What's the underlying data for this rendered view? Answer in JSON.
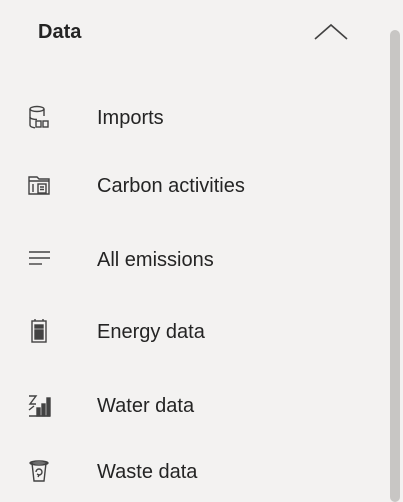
{
  "group": {
    "title": "Data",
    "expanded": true,
    "chevron_icon": "chevron-up-icon"
  },
  "items": [
    {
      "label": "Imports",
      "icon": "database-import-icon"
    },
    {
      "label": "Carbon activities",
      "icon": "activities-document-icon"
    },
    {
      "label": "All emissions",
      "icon": "list-lines-icon"
    },
    {
      "label": "Energy data",
      "icon": "energy-meter-icon"
    },
    {
      "label": "Water data",
      "icon": "water-chart-icon"
    },
    {
      "label": "Waste data",
      "icon": "waste-bin-icon"
    }
  ],
  "colors": {
    "background": "#f3f2f1",
    "text": "#242424",
    "icon": "#424242",
    "scrollbar_thumb": "#c8c6c4"
  }
}
